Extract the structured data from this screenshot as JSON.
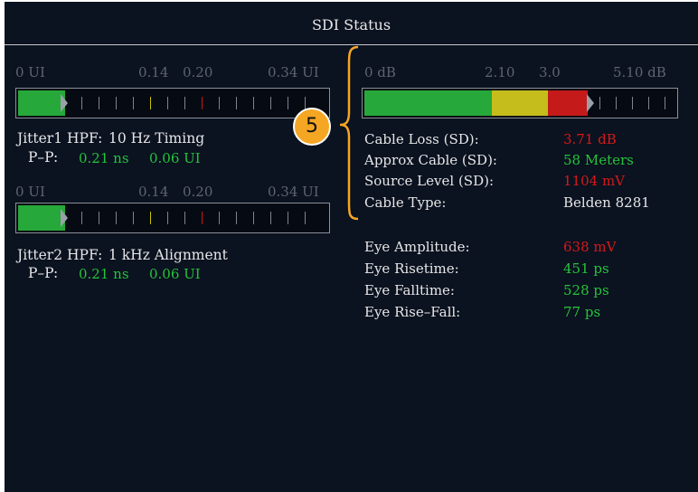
{
  "title": "SDI Status",
  "callout": "5",
  "jitter1": {
    "scale": [
      "0 UI",
      "0.14",
      "0.20",
      "0.34 UI"
    ],
    "level_ui": 0.07,
    "label": "Jitter1 HPF:",
    "hpf": "10 Hz Timing",
    "pp_label": "P–P:",
    "pp_ns": "0.21 ns",
    "pp_ui": "0.06 UI"
  },
  "jitter2": {
    "scale": [
      "0 UI",
      "0.14",
      "0.20",
      "0.34 UI"
    ],
    "level_ui": 0.07,
    "label": "Jitter2 HPF:",
    "hpf": "1 kHz Alignment",
    "pp_label": "P–P:",
    "pp_ns": "0.21 ns",
    "pp_ui": "0.06 UI"
  },
  "cable_meter": {
    "scale": [
      "0 dB",
      "2.10",
      "3.0",
      "5.10 dB"
    ],
    "level_db": 3.71
  },
  "cable": {
    "loss_label": "Cable Loss (SD):",
    "loss_value": "3.71 dB",
    "approx_label": "Approx Cable (SD):",
    "approx_value": "58 Meters",
    "source_label": "Source Level (SD):",
    "source_value": "1104 mV",
    "type_label": "Cable Type:",
    "type_value": "Belden 8281"
  },
  "eye": {
    "amp_label": "Eye Amplitude:",
    "amp_value": "638 mV",
    "rise_label": "Eye Risetime:",
    "rise_value": "451 ps",
    "fall_label": "Eye Falltime:",
    "fall_value": "528 ps",
    "rf_label": "Eye Rise–Fall:",
    "rf_value": "77 ps"
  },
  "colors": {
    "ok": "#25c43a",
    "caution": "#c8c400",
    "alarm": "#d41a1a",
    "callout": "#f5a623"
  }
}
